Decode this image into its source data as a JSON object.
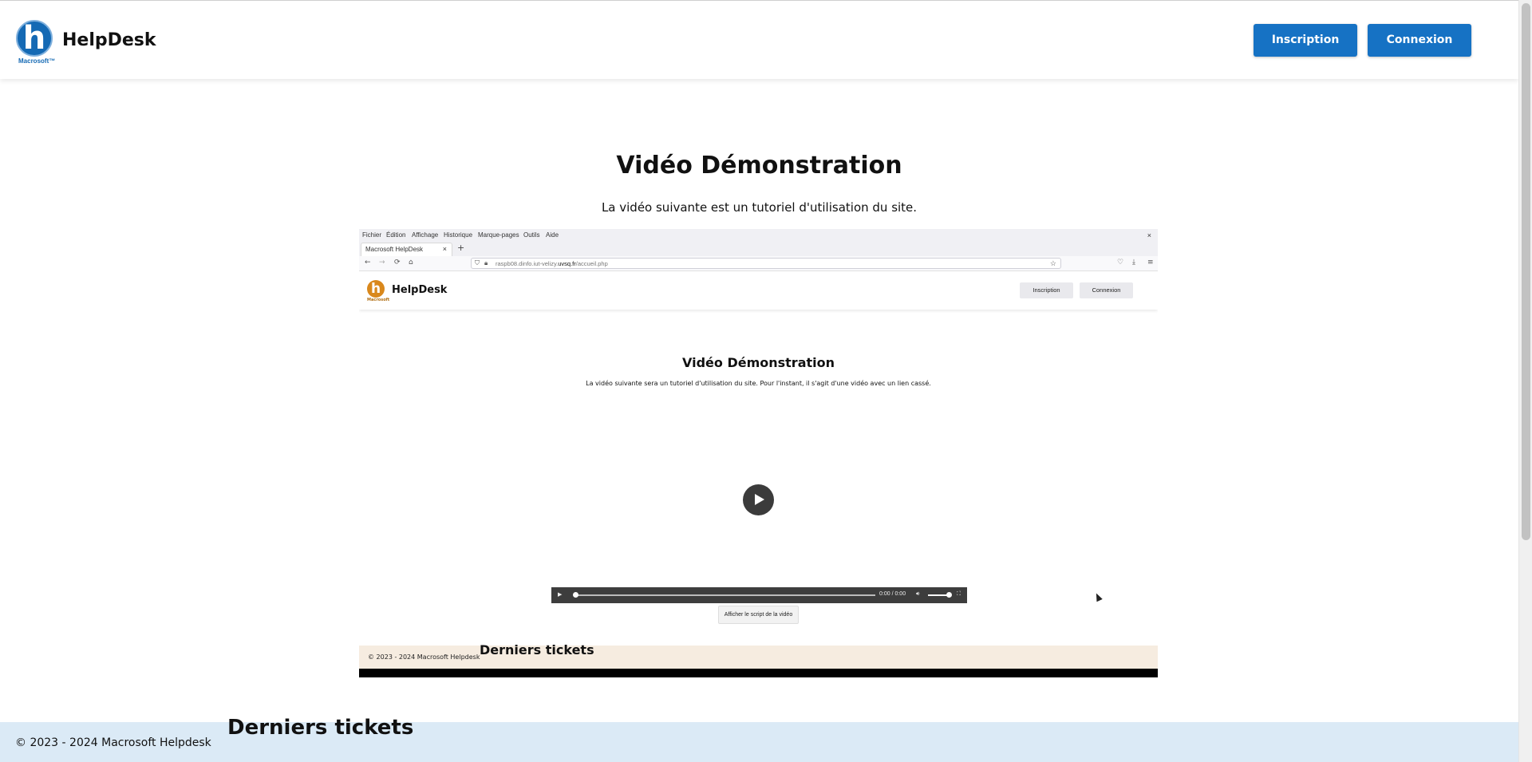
{
  "header": {
    "brand": "HelpDesk",
    "logo_letter": "h",
    "logo_sub": "Macrosoft™",
    "buttons": {
      "signup": "Inscription",
      "login": "Connexion"
    }
  },
  "main": {
    "title": "Vidéo Démonstration",
    "subtitle": "La vidéo suivante est un tutoriel d'utilisation du site."
  },
  "video": {
    "menubar": {
      "items": [
        "Fichier",
        "Édition",
        "Affichage",
        "Historique",
        "Marque-pages",
        "Outils",
        "Aide"
      ],
      "close": "×"
    },
    "tab": {
      "title": "Macrosoft HelpDesk",
      "close": "×",
      "new": "+"
    },
    "nav": {
      "back": "←",
      "forward": "→",
      "reload": "⟳",
      "home": "⌂",
      "url_prefix": "raspb08.dinfo.iut-velizy.",
      "url_domain": "uvsq.fr",
      "url_path": "/accueil.php",
      "bookmark": "☆",
      "pocket": "♡",
      "download": "⤓",
      "menu": "≡"
    },
    "site": {
      "brand": "HelpDesk",
      "logo_letter": "h",
      "logo_sub": "Macrosoft",
      "signup": "Inscription",
      "login": "Connexion",
      "title": "Vidéo Démonstration",
      "subtitle": "La vidéo suivante sera un tutoriel d'utilisation du site. Pour l'instant, il s'agit d'une vidéo avec un lien cassé.",
      "time": "0:00 / 0:00",
      "script_button": "Afficher le script de la vidéo",
      "footer": "© 2023 - 2024 Macrosoft Helpdesk",
      "tickets": "Derniers tickets"
    }
  },
  "footer": {
    "text": "© 2023 - 2024 Macrosoft Helpdesk",
    "tickets_heading": "Derniers tickets"
  },
  "colors": {
    "accent": "#1672c4",
    "footer_bg": "#dbeaf6",
    "video_footer_bg": "#f6ece0"
  }
}
